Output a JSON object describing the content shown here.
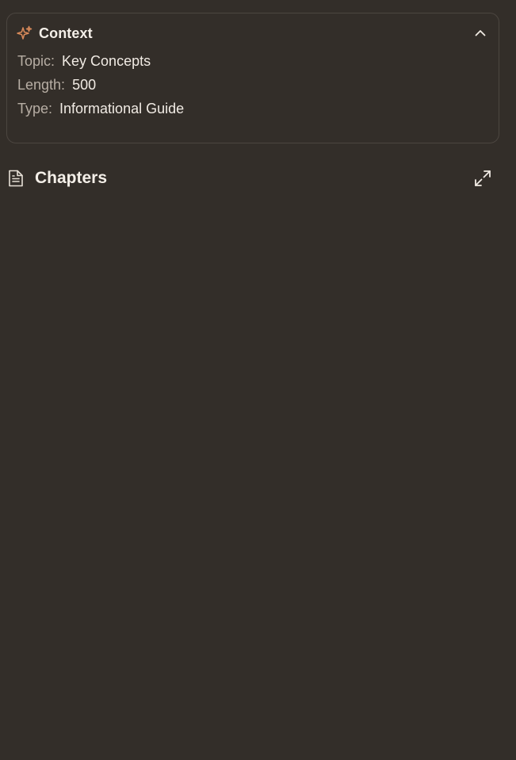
{
  "context": {
    "title": "Context",
    "icon": "sparkle-icon",
    "accent_color": "#d98a5a",
    "collapse_icon": "chevron-up-icon",
    "rows": [
      {
        "label": "Topic:",
        "value": "Key Concepts"
      },
      {
        "label": "Length:",
        "value": "500"
      },
      {
        "label": "Type:",
        "value": "Informational Guide"
      }
    ]
  },
  "chapters": {
    "title": "Chapters",
    "icon": "document-icon",
    "expand_icon": "expand-icon"
  },
  "colors": {
    "background": "#332e29",
    "border": "#4c4640",
    "label": "#b7aea4",
    "text": "#f1ebe4"
  }
}
